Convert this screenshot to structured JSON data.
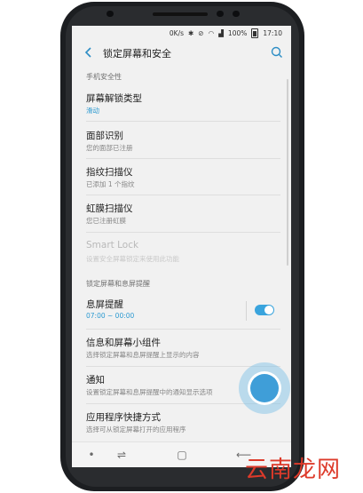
{
  "status_bar": {
    "speed": "0K/s",
    "battery": "100%",
    "time": "17:10"
  },
  "header": {
    "title": "锁定屏幕和安全"
  },
  "sections": {
    "phone_security": "手机安全性",
    "lock_screen_aod": "锁定屏幕和息屏提醒"
  },
  "items": {
    "screen_lock_type": {
      "title": "屏幕解锁类型",
      "subtitle": "滑动"
    },
    "face_recognition": {
      "title": "面部识别",
      "subtitle": "您的面部已注册"
    },
    "fingerprint_scanner": {
      "title": "指纹扫描仪",
      "subtitle": "已添加 1 个指纹"
    },
    "iris_scanner": {
      "title": "虹膜扫描仪",
      "subtitle": "您已注册虹膜"
    },
    "smart_lock": {
      "title": "Smart Lock",
      "subtitle": "设置安全屏幕锁定来使用此功能"
    },
    "always_on_display": {
      "title": "息屏提醒",
      "subtitle": "07:00 ~ 00:00",
      "enabled": true
    },
    "info_widgets": {
      "title": "信息和屏幕小组件",
      "subtitle": "选择锁定屏幕和息屏提醒上显示的内容"
    },
    "notifications": {
      "title": "通知",
      "subtitle": "设置锁定屏幕和息屏提醒中的通知显示选项"
    },
    "app_shortcuts": {
      "title": "应用程序快捷方式",
      "subtitle": "选择可从锁定屏幕打开的应用程序"
    }
  },
  "watermark": {
    "text": "云南龙网"
  },
  "colors": {
    "accent": "#2d9ad1",
    "touch_indicator": "#3f9ed8",
    "watermark": "#dd3a2a"
  }
}
